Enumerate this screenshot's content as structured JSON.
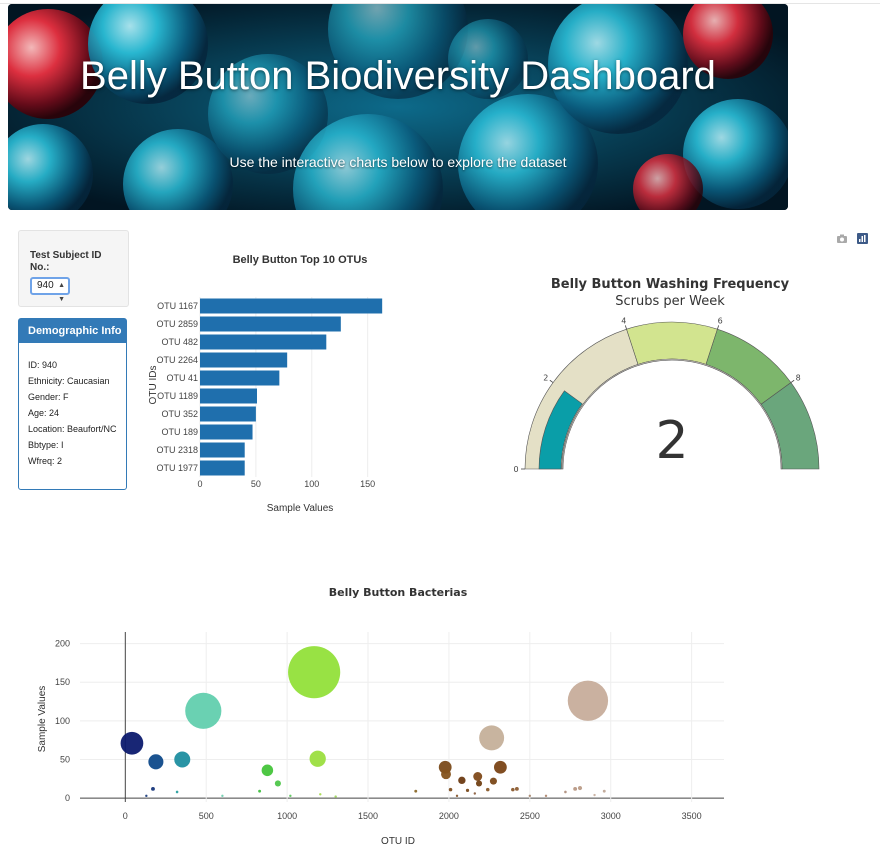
{
  "hero": {
    "title": "Belly Button Biodiversity Dashboard",
    "subtitle": "Use the interactive charts below to explore the dataset"
  },
  "selector": {
    "label": "Test Subject ID No.:",
    "value": "940"
  },
  "demographics": {
    "title": "Demographic Info",
    "rows": [
      "ID: 940",
      "Ethnicity: Caucasian",
      "Gender: F",
      "Age: 24",
      "Location: Beaufort/NC",
      "Bbtype: I",
      "Wfreq: 2"
    ]
  },
  "modebar": {
    "camera_icon": "camera-icon",
    "plotly_icon": "plotly-logo-icon"
  },
  "bar_chart": {
    "chart_data": {
      "type": "bar",
      "orientation": "horizontal",
      "title": "Belly Button Top 10 OTUs",
      "xlabel": "Sample Values",
      "ylabel": "OTU IDs",
      "categories": [
        "OTU 1167",
        "OTU 2859",
        "OTU 482",
        "OTU 2264",
        "OTU 41",
        "OTU 1189",
        "OTU 352",
        "OTU 189",
        "OTU 2318",
        "OTU 1977"
      ],
      "values": [
        163,
        126,
        113,
        78,
        71,
        51,
        50,
        47,
        40,
        40
      ],
      "xlim": [
        0,
        170
      ],
      "xticks": [
        0,
        50,
        100,
        150
      ],
      "color": "#1f6fad"
    }
  },
  "gauge": {
    "chart_data": {
      "type": "gauge",
      "title": "Belly Button Washing Frequency",
      "subtitle": "Scrubs per Week",
      "value": 2,
      "range": [
        0,
        10
      ],
      "ticks": [
        "0",
        "2",
        "4",
        "6",
        "8"
      ],
      "bands": [
        {
          "from": 0,
          "to": 4,
          "color": "#e4e0c6"
        },
        {
          "from": 4,
          "to": 6,
          "color": "#d2e48f"
        },
        {
          "from": 6,
          "to": 8,
          "color": "#7db66c"
        },
        {
          "from": 8,
          "to": 10,
          "color": "#6aa67c"
        }
      ],
      "bar_color": "#0a9ea8",
      "track_color": "#f5f0e6"
    }
  },
  "bubble_chart": {
    "chart_data": {
      "type": "scatter",
      "title": "Belly Button Bacterias",
      "xlabel": "OTU ID",
      "ylabel": "Sample Values",
      "xlim": [
        -280,
        3700
      ],
      "ylim": [
        -5,
        215
      ],
      "xticks": [
        0,
        500,
        1000,
        1500,
        2000,
        2500,
        3000,
        3500
      ],
      "yticks": [
        0,
        50,
        100,
        150,
        200
      ],
      "points": [
        {
          "x": 41,
          "y": 71,
          "color": "#0c1a6e"
        },
        {
          "x": 189,
          "y": 47,
          "color": "#0f4a8a"
        },
        {
          "x": 352,
          "y": 50,
          "color": "#1d8ea0"
        },
        {
          "x": 482,
          "y": 113,
          "color": "#62cfae"
        },
        {
          "x": 1167,
          "y": 163,
          "color": "#92e03a"
        },
        {
          "x": 1189,
          "y": 51,
          "color": "#9bde3f"
        },
        {
          "x": 878,
          "y": 36,
          "color": "#45c43a"
        },
        {
          "x": 943,
          "y": 19,
          "color": "#4ec64a"
        },
        {
          "x": 2264,
          "y": 78,
          "color": "#c5b09a"
        },
        {
          "x": 2859,
          "y": 126,
          "color": "#c7ad9b"
        },
        {
          "x": 1977,
          "y": 40,
          "color": "#7a4a1a"
        },
        {
          "x": 1982,
          "y": 31,
          "color": "#84531e"
        },
        {
          "x": 2318,
          "y": 40,
          "color": "#7a4516"
        },
        {
          "x": 2178,
          "y": 28,
          "color": "#7f4a1a"
        },
        {
          "x": 2080,
          "y": 23,
          "color": "#6b3a12"
        },
        {
          "x": 2275,
          "y": 22,
          "color": "#7a4818"
        },
        {
          "x": 2186,
          "y": 19,
          "color": "#714014"
        },
        {
          "x": 2240,
          "y": 11,
          "color": "#8a5a2a"
        },
        {
          "x": 2010,
          "y": 11,
          "color": "#7e4e20"
        },
        {
          "x": 2115,
          "y": 10,
          "color": "#7a4a1c"
        },
        {
          "x": 2395,
          "y": 11,
          "color": "#8a5a2e"
        },
        {
          "x": 2420,
          "y": 12,
          "color": "#8d5d33"
        },
        {
          "x": 2160,
          "y": 6,
          "color": "#8c6040"
        },
        {
          "x": 1795,
          "y": 9,
          "color": "#8c6a2a"
        },
        {
          "x": 2780,
          "y": 12,
          "color": "#b89884"
        },
        {
          "x": 2810,
          "y": 13,
          "color": "#bb9c88"
        },
        {
          "x": 2720,
          "y": 8,
          "color": "#b09080"
        },
        {
          "x": 2960,
          "y": 9,
          "color": "#c0a898"
        },
        {
          "x": 171,
          "y": 12,
          "color": "#15357a"
        },
        {
          "x": 320,
          "y": 8,
          "color": "#2aa0a0"
        },
        {
          "x": 830,
          "y": 9,
          "color": "#40c040"
        },
        {
          "x": 1205,
          "y": 5,
          "color": "#a8dc50"
        },
        {
          "x": 1020,
          "y": 3,
          "color": "#60c860"
        },
        {
          "x": 2500,
          "y": 3,
          "color": "#a88870"
        },
        {
          "x": 2600,
          "y": 3,
          "color": "#b08870"
        },
        {
          "x": 2900,
          "y": 4,
          "color": "#c8b0a0"
        },
        {
          "x": 130,
          "y": 3,
          "color": "#204080"
        },
        {
          "x": 600,
          "y": 3,
          "color": "#70d0b0"
        },
        {
          "x": 1300,
          "y": 2,
          "color": "#a0d860"
        },
        {
          "x": 2050,
          "y": 3,
          "color": "#8a5a30"
        }
      ]
    }
  }
}
